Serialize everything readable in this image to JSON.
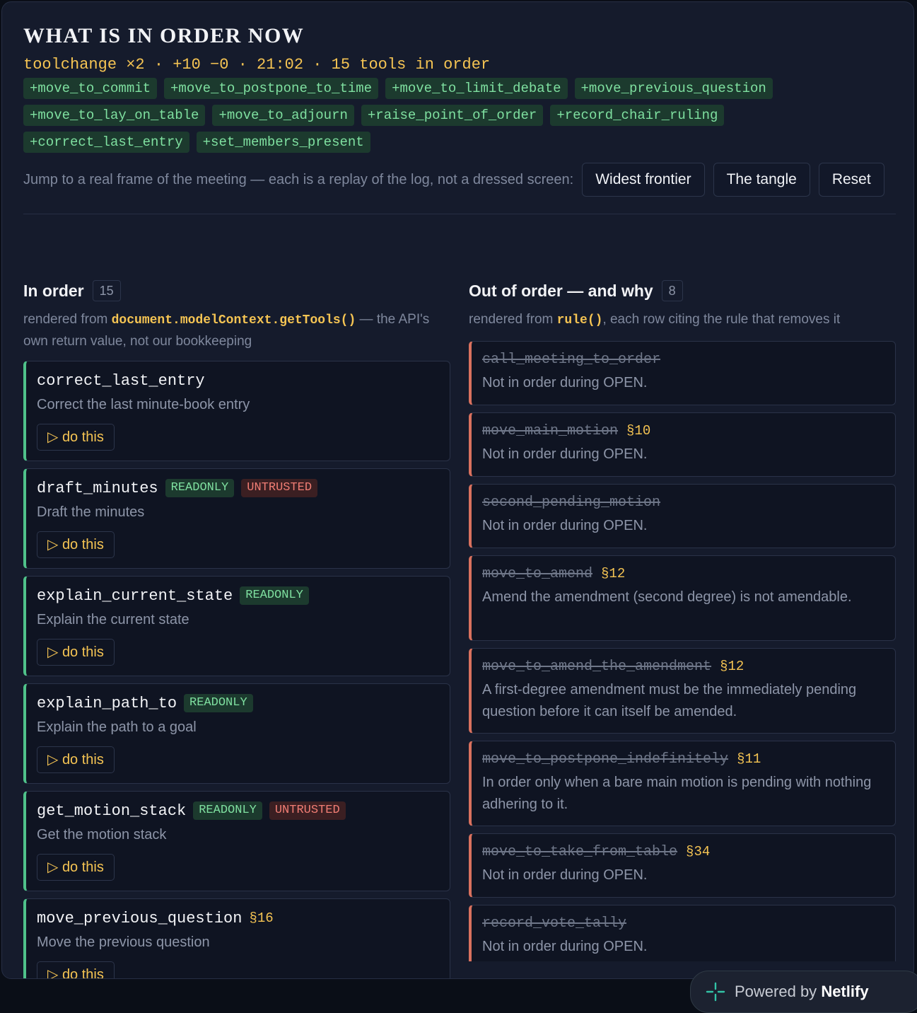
{
  "header": {
    "title": "WHAT IS IN ORDER NOW",
    "summary": "toolchange ×2 · +10 −0 · 21:02 · 15 tools in order",
    "added_chips": [
      "+move_to_commit",
      "+move_to_postpone_to_time",
      "+move_to_limit_debate",
      "+move_previous_question",
      "+move_to_lay_on_table",
      "+move_to_adjourn",
      "+raise_point_of_order",
      "+record_chair_ruling",
      "+correct_last_entry",
      "+set_members_present"
    ]
  },
  "jump": {
    "text": "Jump to a real frame of the meeting — each is a replay of the log, not a dressed screen:",
    "buttons": [
      "Widest frontier",
      "The tangle",
      "Reset"
    ]
  },
  "in_order": {
    "title": "In order",
    "count": "15",
    "sub_prefix": "rendered from ",
    "sub_code": "document.modelContext.getTools()",
    "sub_suffix": " — the API's own return value, not our bookkeeping",
    "do_label": "▷ do this",
    "tools": [
      {
        "name": "correct_last_entry",
        "desc": "Correct the last minute-book entry",
        "badges": [],
        "section": ""
      },
      {
        "name": "draft_minutes",
        "desc": "Draft the minutes",
        "badges": [
          "READONLY",
          "UNTRUSTED"
        ],
        "section": ""
      },
      {
        "name": "explain_current_state",
        "desc": "Explain the current state",
        "badges": [
          "READONLY"
        ],
        "section": ""
      },
      {
        "name": "explain_path_to",
        "desc": "Explain the path to a goal",
        "badges": [
          "READONLY"
        ],
        "section": ""
      },
      {
        "name": "get_motion_stack",
        "desc": "Get the motion stack",
        "badges": [
          "READONLY",
          "UNTRUSTED"
        ],
        "section": ""
      },
      {
        "name": "move_previous_question",
        "desc": "Move the previous question",
        "badges": [],
        "section": "§16"
      }
    ]
  },
  "out_of_order": {
    "title": "Out of order — and why",
    "count": "8",
    "sub_prefix": "rendered from ",
    "sub_code": "rule()",
    "sub_suffix": ", each row citing the rule that removes it",
    "rules": [
      {
        "name": "call_meeting_to_order",
        "section": "",
        "reason": "Not in order during OPEN."
      },
      {
        "name": "move_main_motion",
        "section": "§10",
        "reason": "Not in order during OPEN."
      },
      {
        "name": "second_pending_motion",
        "section": "",
        "reason": "Not in order during OPEN."
      },
      {
        "name": "move_to_amend",
        "section": "§12",
        "reason": "Amend the amendment (second degree) is not amendable."
      },
      {
        "name": "move_to_amend_the_amendment",
        "section": "§12",
        "reason": "A first-degree amendment must be the immediately pending question before it can itself be amended."
      },
      {
        "name": "move_to_postpone_indefinitely",
        "section": "§11",
        "reason": "In order only when a bare main motion is pending with nothing adhering to it."
      },
      {
        "name": "move_to_take_from_table",
        "section": "§34",
        "reason": "Not in order during OPEN."
      },
      {
        "name": "record_vote_tally",
        "section": "",
        "reason": "Not in order during OPEN."
      }
    ]
  },
  "footer": {
    "powered_by": "Powered by",
    "brand": "Netlify",
    "icon": "netlify-icon"
  },
  "colors": {
    "accent_yellow": "#f5c453",
    "in_order_green": "#4fc28a",
    "out_of_order_red": "#d9715e"
  }
}
